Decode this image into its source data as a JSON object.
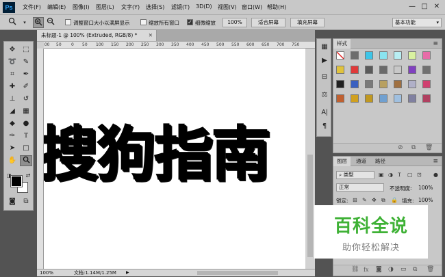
{
  "app": {
    "logo": "Ps"
  },
  "menubar": {
    "items": [
      "文件(F)",
      "编辑(E)",
      "图像(I)",
      "图层(L)",
      "文字(Y)",
      "选择(S)",
      "滤镜(T)",
      "3D(D)",
      "视图(V)",
      "窗口(W)",
      "帮助(H)"
    ],
    "minimize": "—",
    "maximize": "□",
    "close": "✕"
  },
  "options": {
    "zoom_tool_icon": "zoom-icon",
    "check1_label": "调整窗口大小以满屏显示",
    "check2_label": "缩放所有窗口",
    "check3_label": "细微缩放",
    "zoom_value": "100%",
    "fit_screen": "适合屏幕",
    "fill_screen": "填充屏幕",
    "workspace": "基本功能"
  },
  "document": {
    "tab_title": "未标题-1 @ 100% (Extruded, RGB/8) *",
    "canvas_text": "搜狗指南",
    "ruler_ticks": [
      "100",
      "50",
      "0",
      "50",
      "100",
      "150",
      "200",
      "250",
      "300",
      "350",
      "400",
      "450",
      "500",
      "550",
      "600",
      "650",
      "700",
      "750"
    ],
    "zoom": "100%",
    "doc_size": "文档:1.14M/1.25M"
  },
  "styles_panel": {
    "tab": "样式",
    "swatch_colors": [
      "#ffffff",
      "#6d6d6d",
      "#3ec5e8",
      "#8ae3ef",
      "#b8eef3",
      "#d9f2a0",
      "#e86ca8",
      "#e0c23c",
      "#e03a3a",
      "#5a5a5a",
      "#6a6a6a",
      "#c8c8c8",
      "#8040c0",
      "#707070",
      "#202020",
      "#3a60c0",
      "#7a7a7a",
      "#b8a060",
      "#a07040",
      "#b0b0c8",
      "#d04070",
      "#c06030",
      "#d0a020",
      "#c09820",
      "#70a0d0",
      "#a0c0e0",
      "#8080a0",
      "#b04060"
    ]
  },
  "layers_panel": {
    "tabs": [
      "图层",
      "通道",
      "路径"
    ],
    "filter_label": "类型",
    "blend_mode": "正常",
    "opacity_label": "不透明度:",
    "opacity_value": "100%",
    "lock_label": "锁定:",
    "fill_label": "填充:",
    "fill_value": "100%"
  },
  "watermark": {
    "title": "百科全说",
    "subtitle": "助你轻松解决"
  }
}
